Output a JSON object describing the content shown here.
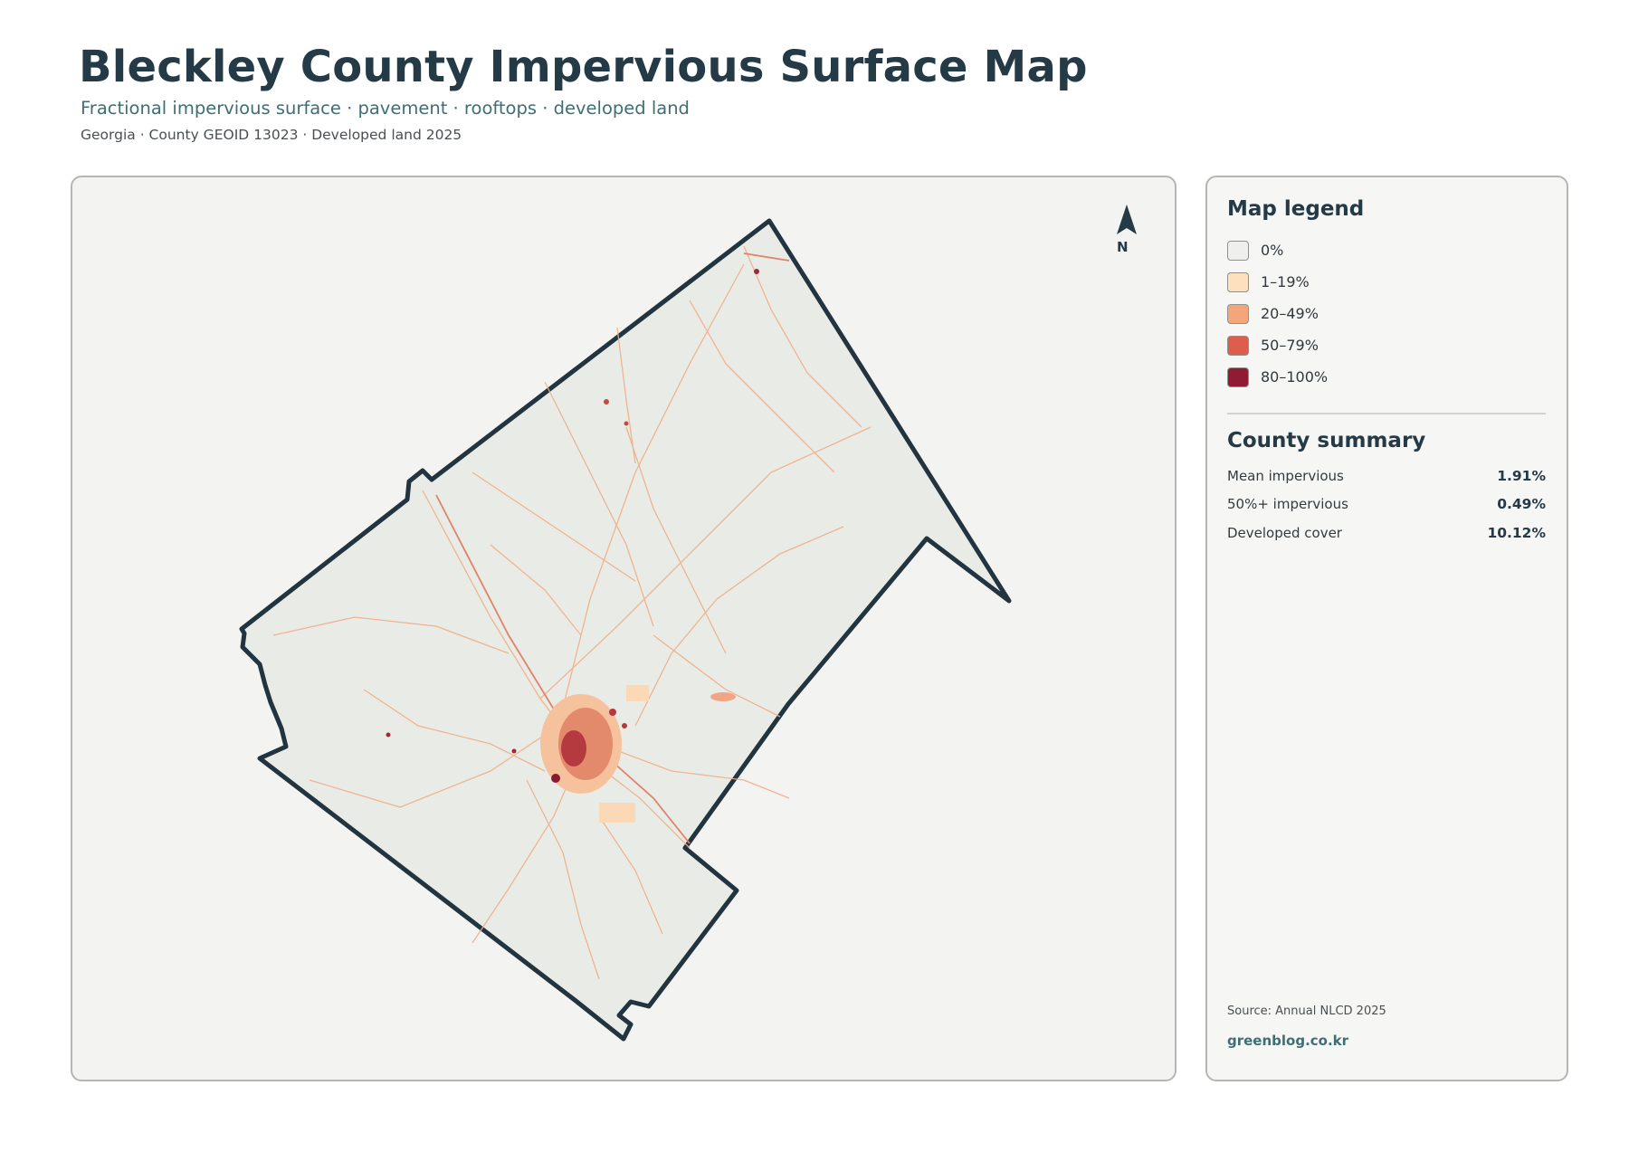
{
  "header": {
    "title": "Bleckley County Impervious Surface Map",
    "subtitle": "Fractional impervious surface · pavement · rooftops · developed land",
    "meta": "Georgia · County GEOID 13023 · Developed land 2025"
  },
  "map": {
    "north_label": "N",
    "colors": {
      "county_fill": "#e9ece6",
      "county_outline": "#22343f",
      "road_light": "#f6c9a2",
      "road_medium": "#eda27e",
      "urban_high": "#8a1a2e"
    }
  },
  "legend": {
    "title": "Map legend",
    "items": [
      {
        "label": "0%",
        "color": "#efefed"
      },
      {
        "label": "1–19%",
        "color": "#fde0bc"
      },
      {
        "label": "20–49%",
        "color": "#f4a57c"
      },
      {
        "label": "50–79%",
        "color": "#dd5f4b"
      },
      {
        "label": "80–100%",
        "color": "#8f1c32"
      }
    ]
  },
  "summary": {
    "title": "County summary",
    "stats": [
      {
        "label": "Mean impervious",
        "value": "1.91%"
      },
      {
        "label": "50%+ impervious",
        "value": "0.49%"
      },
      {
        "label": "Developed cover",
        "value": "10.12%"
      }
    ]
  },
  "footer": {
    "source": "Source: Annual NLCD 2025",
    "credit": "greenblog.co.kr"
  }
}
